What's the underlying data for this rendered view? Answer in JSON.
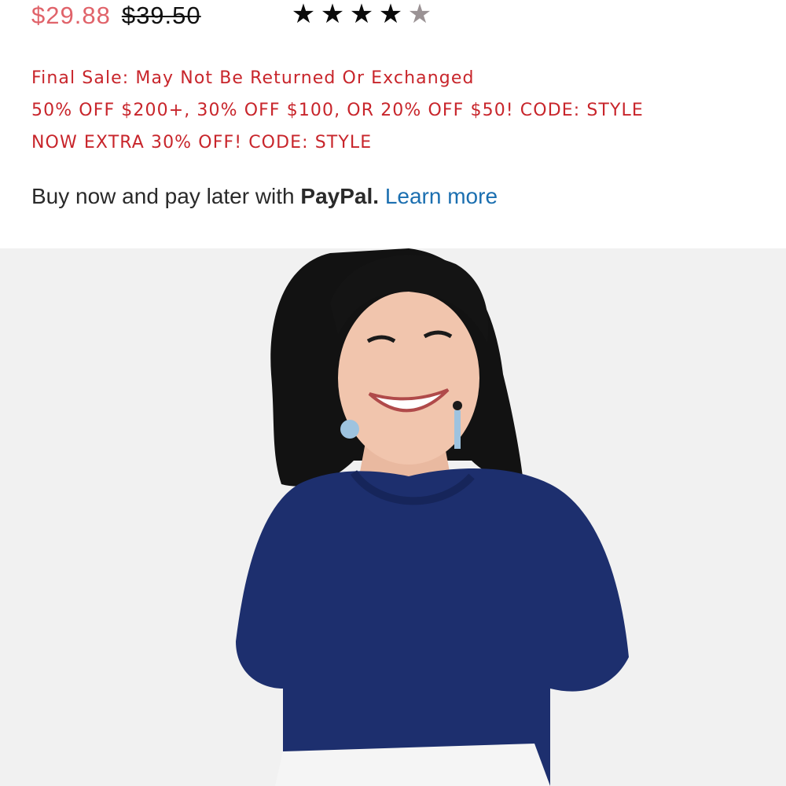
{
  "pricing": {
    "sale_price": "$29.88",
    "original_price": "$39.50"
  },
  "rating": {
    "value": 4,
    "max": 5,
    "full_star_color": "#0a0a0a",
    "empty_star_color": "#9a9294"
  },
  "promos": [
    "Final Sale: May Not Be Returned Or Exchanged",
    "50% OFF $200+, 30% OFF $100, OR 20% OFF $50! CODE: STYLE",
    "NOW EXTRA 30% OFF! CODE: STYLE"
  ],
  "paypal": {
    "message": "Buy now and pay later with",
    "brand": "PayPal.",
    "link_label": "Learn more"
  },
  "product_image": {
    "icon": "model-photo",
    "top_color": "#1d2f6e",
    "background_color": "#f1f1f1"
  },
  "colors": {
    "sale_price": "#e0636a",
    "promo_text": "#c8252b",
    "link": "#1b6fb0"
  }
}
